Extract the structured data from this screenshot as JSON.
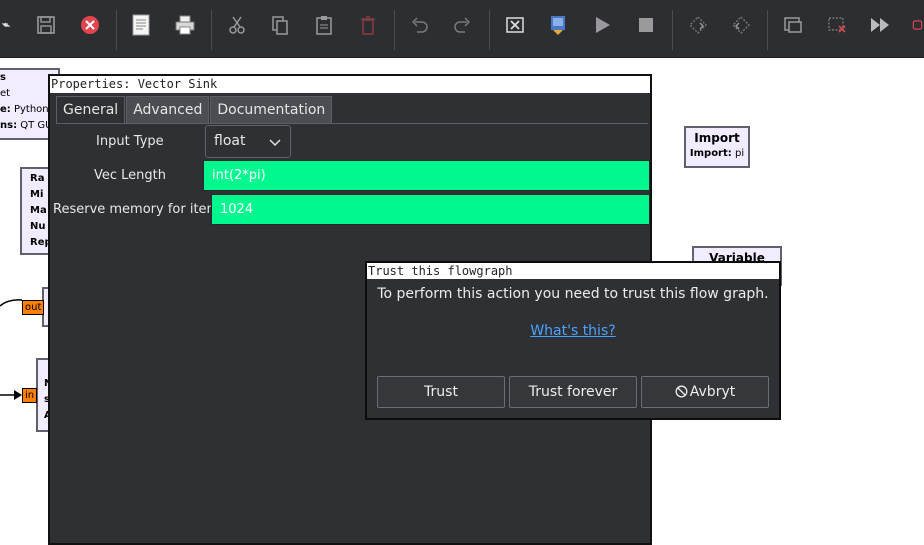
{
  "window": {
    "title_fragment": "p"
  },
  "toolbar": {
    "icons": [
      "chevron-down-icon",
      "save-icon",
      "close-icon",
      "document-icon",
      "print-icon",
      "cut-icon",
      "copy-icon",
      "paste-icon",
      "delete-icon",
      "undo-icon",
      "redo-icon",
      "errors-icon",
      "generate-icon",
      "run-icon",
      "stop-icon",
      "rotate-ccw-icon",
      "rotate-cw-icon",
      "enable-icon",
      "disable-icon",
      "bypass-icon",
      "kill-icon"
    ]
  },
  "canvas": {
    "block_top_left": {
      "line1": "s",
      "line2": "et",
      "line3_key": "e:",
      "line3_val": "Python",
      "line4_key": "ns:",
      "line4_val": "QT GU"
    },
    "block_random": {
      "line1": "Ra",
      "line2": "Mi",
      "line3": "Ma",
      "line4": "Nu",
      "line5": "Rep"
    },
    "block_import": {
      "title": "Import",
      "key": "Import:",
      "value": "pi"
    },
    "block_variable": {
      "title": "Variable"
    },
    "port_out": "out",
    "port_in": "in",
    "block_lower_left": {
      "line1": "N",
      "line2": "s",
      "line3": "A"
    }
  },
  "properties": {
    "title": "Properties: Vector Sink",
    "tabs": [
      "General",
      "Advanced",
      "Documentation"
    ],
    "params": {
      "input_type_label": "Input Type",
      "input_type_value": "float",
      "vec_length_label": "Vec Length",
      "vec_length_value": "int(2*pi)",
      "reserve_label": "Reserve memory for items",
      "reserve_value": "1024"
    },
    "field_color": "#00f88e"
  },
  "trust_dialog": {
    "title": "Trust this flowgraph",
    "message": "To perform this action you need to trust this flow graph.",
    "link": "What's this?",
    "buttons": {
      "trust": "Trust",
      "trust_forever": "Trust forever",
      "cancel": "Avbryt"
    },
    "link_color": "#4aa3ff"
  }
}
